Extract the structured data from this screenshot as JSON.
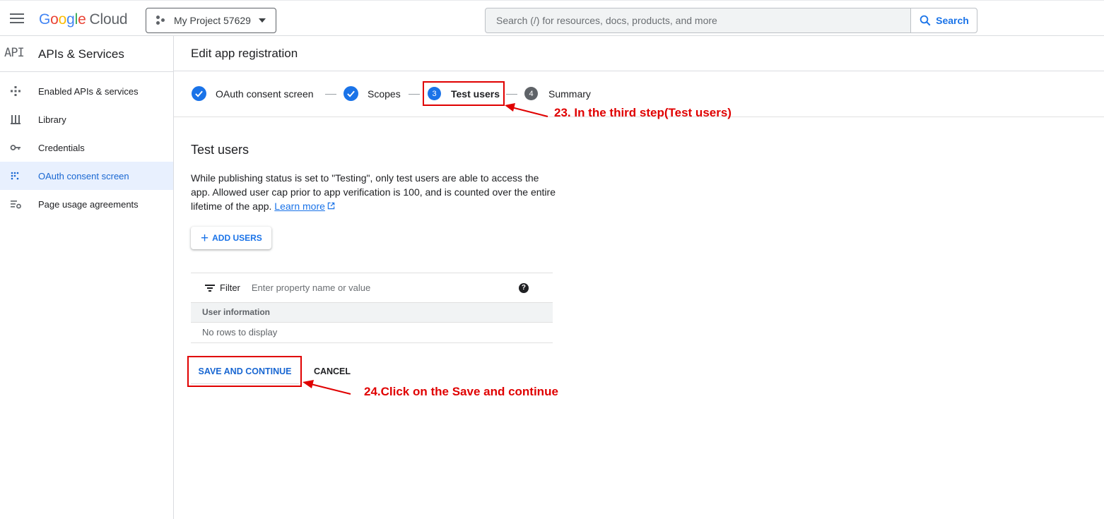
{
  "topbar": {
    "logo_letters": [
      "G",
      "o",
      "o",
      "g",
      "l",
      "e"
    ],
    "logo_suffix": "Cloud",
    "project_name": "My Project 57629",
    "search_placeholder": "Search (/) for resources, docs, products, and more",
    "search_button": "Search"
  },
  "sidebar": {
    "logo": "API",
    "title": "APIs & Services",
    "items": [
      {
        "label": "Enabled APIs & services",
        "icon": "enabled-apis-icon"
      },
      {
        "label": "Library",
        "icon": "library-icon"
      },
      {
        "label": "Credentials",
        "icon": "key-icon"
      },
      {
        "label": "OAuth consent screen",
        "icon": "oauth-icon",
        "active": true
      },
      {
        "label": "Page usage agreements",
        "icon": "settings-list-icon"
      }
    ]
  },
  "main": {
    "title": "Edit app registration",
    "steps": [
      {
        "number": "",
        "label": "OAuth consent screen",
        "state": "done"
      },
      {
        "number": "",
        "label": "Scopes",
        "state": "done"
      },
      {
        "number": "3",
        "label": "Test users",
        "state": "current"
      },
      {
        "number": "4",
        "label": "Summary",
        "state": "todo"
      }
    ],
    "section_title": "Test users",
    "description": "While publishing status is set to \"Testing\", only test users are able to access the app. Allowed user cap prior to app verification is 100, and is counted over the entire lifetime of the app.",
    "learn_more": "Learn more",
    "add_users": "ADD USERS",
    "filter_label": "Filter",
    "filter_placeholder": "Enter property name or value",
    "table_header": "User information",
    "empty_text": "No rows to display",
    "save_button": "SAVE AND CONTINUE",
    "cancel_button": "CANCEL"
  },
  "annotations": {
    "step23": "23. In the third step(Test users)",
    "step24": "24.Click on the Save and continue",
    "color": "#e00000"
  },
  "colors": {
    "accent": "#1a73e8",
    "active_bg": "#e8f0fe"
  }
}
